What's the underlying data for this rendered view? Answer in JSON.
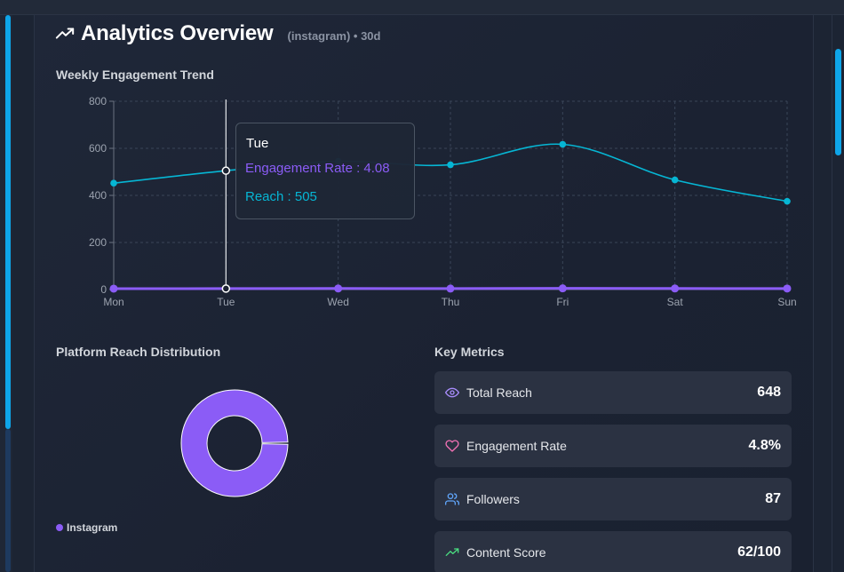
{
  "header": {
    "title": "Analytics Overview",
    "subtitle": "(instagram) • 30d",
    "icon": "trending-up-icon"
  },
  "engagement": {
    "section_title": "Weekly Engagement Trend"
  },
  "tooltip": {
    "title": "Tue",
    "row1": "Engagement Rate : 4.08",
    "row2": "Reach : 505"
  },
  "distribution": {
    "section_title": "Platform Reach Distribution",
    "legend_label": "Instagram"
  },
  "metrics": {
    "section_title": "Key Metrics",
    "items": [
      {
        "label": "Total Reach",
        "value": "648",
        "icon": "eye-icon",
        "color": "#a78bfa"
      },
      {
        "label": "Engagement Rate",
        "value": "4.8%",
        "icon": "heart-icon",
        "color": "#f472b6"
      },
      {
        "label": "Followers",
        "value": "87",
        "icon": "users-icon",
        "color": "#60a5fa"
      },
      {
        "label": "Content Score",
        "value": "62/100",
        "icon": "trending-up-icon",
        "color": "#4ade80"
      }
    ]
  },
  "colors": {
    "reach": "#06b6d4",
    "engagement": "#8b5cf6",
    "accent": "#0ea5e9"
  },
  "chart_data": [
    {
      "type": "line",
      "categories": [
        "Mon",
        "Tue",
        "Wed",
        "Thu",
        "Fri",
        "Sat",
        "Sun"
      ],
      "series": [
        {
          "name": "Engagement Rate",
          "values": [
            3.9,
            4.08,
            4.5,
            4.2,
            5.1,
            4.6,
            4.3
          ]
        },
        {
          "name": "Reach",
          "values": [
            452,
            505,
            545,
            530,
            617,
            466,
            375
          ]
        }
      ],
      "yticks": [
        0,
        200,
        400,
        600,
        800
      ],
      "ylim": [
        0,
        800
      ],
      "grid": true,
      "hover_category": "Tue"
    },
    {
      "type": "pie",
      "categories": [
        "Instagram"
      ],
      "values": [
        648
      ]
    }
  ]
}
